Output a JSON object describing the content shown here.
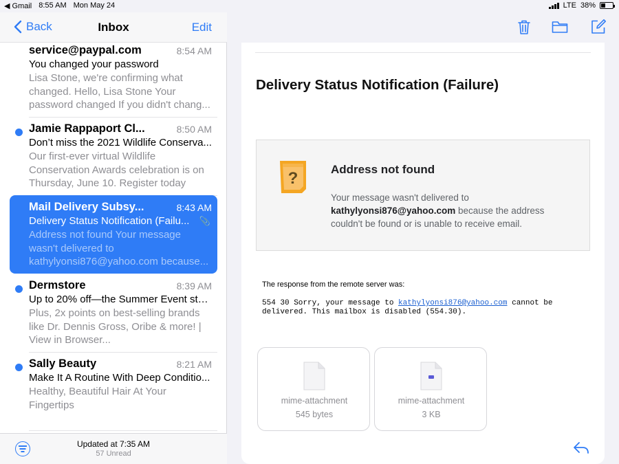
{
  "status_bar": {
    "back_app": "◀ Gmail",
    "time": "8:55 AM",
    "date": "Mon May 24",
    "network": "LTE",
    "battery": "38%",
    "battery_level": 0.38
  },
  "nav": {
    "back_label": "Back",
    "title": "Inbox",
    "edit_label": "Edit"
  },
  "mails": [
    {
      "sender": "service@paypal.com",
      "time": "8:54 AM",
      "subject": "You changed your password",
      "preview": "Lisa Stone, we're confirming what changed. Hello, Lisa Stone Your password changed If you didn't chang...",
      "unread": false,
      "selected": false
    },
    {
      "sender": "Jamie Rappaport Cl...",
      "time": "8:50 AM",
      "subject": "Don’t miss the 2021 Wildlife Conserva...",
      "preview": "Our first-ever virtual Wildlife Conservation Awards celebration is on Thursday, June 10. Register today",
      "unread": true,
      "selected": false
    },
    {
      "sender": "Mail Delivery Subsy...",
      "time": "8:43 AM",
      "subject": "Delivery Status Notification (Failu...",
      "preview": "Address not found Your message wasn't delivered to kathylyonsi876@yahoo.com because...",
      "unread": false,
      "selected": true
    },
    {
      "sender": "Dermstore",
      "time": "8:39 AM",
      "subject": "Up to 20% off—the Summer Event sta...",
      "preview": "Plus, 2x points on best-selling brands like Dr. Dennis Gross, Oribe & more! | View in Browser...",
      "unread": true,
      "selected": false
    },
    {
      "sender": "Sally Beauty",
      "time": "8:21 AM",
      "subject": "Make It A Routine With Deep Conditio...",
      "preview": "Healthy, Beautiful Hair At Your Fingertips",
      "unread": true,
      "selected": false
    }
  ],
  "list_footer": {
    "updated": "Updated at 7:35 AM",
    "unread": "57 Unread"
  },
  "message": {
    "title": "Delivery Status Notification (Failure)",
    "notice_heading": "Address not found",
    "notice_line1": "Your message wasn't delivered to",
    "notice_email": "kathylyonsi876@yahoo.com",
    "notice_line2": "because the address couldn't be found or is unable to receive email.",
    "remote_label": "The response from the remote server was:",
    "remote_pre": "554 30 Sorry, your message to",
    "remote_email": "kathylyonsi876@yahoo.com",
    "remote_post": "cannot be delivered. This mailbox is disabled (554.30).",
    "attachments": [
      {
        "name": "mime-attachment",
        "size": "545 bytes"
      },
      {
        "name": "mime-attachment",
        "size": "3 KB"
      }
    ]
  },
  "icons": {
    "trash": "trash-icon",
    "folder": "folder-icon",
    "compose": "compose-icon",
    "reply": "reply-icon",
    "filter": "filter-icon",
    "warning": "question-note-icon"
  },
  "colors": {
    "accent": "#2f7cf6",
    "notice_icon": "#f4a623"
  }
}
